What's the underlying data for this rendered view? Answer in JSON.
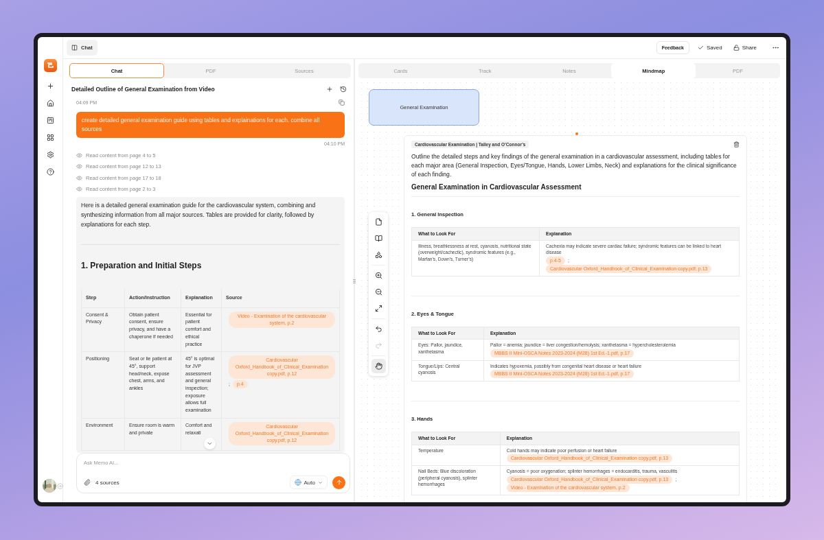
{
  "top_bar": {
    "panel_toggle": "Chat",
    "feedback": "Feedback",
    "saved": "Saved",
    "share": "Share"
  },
  "source_separator": ";",
  "left_panel": {
    "tabs": [
      {
        "label": "Chat",
        "selected": true
      },
      {
        "label": "PDF",
        "selected": false
      },
      {
        "label": "Sources",
        "selected": false
      }
    ],
    "title": "Detailed Outline of General Examination from Video",
    "user_time": "04:09 PM",
    "user_message": "create detailed general examination guide using tables and explainations for each. combine all sources",
    "reply_time": "04:10 PM",
    "steps": [
      "Read content from page 4 to 5",
      "Read content from page 12 to 13",
      "Read content from page 17 to 18",
      "Read content from page 2 to 3"
    ],
    "answer": {
      "intro": "Here is a detailed general examination guide for the cardiovascular system, combining and synthesizing information from all major sources. Tables are provided for clarity, followed by explanations for each step.",
      "heading": "1. Preparation and Initial Steps",
      "columns": [
        "Step",
        "Action/Instruction",
        "Explanation",
        "Source"
      ],
      "rows": [
        {
          "cells": [
            "Consent & Privacy",
            "Obtain patient consent, ensure privacy, and have a chaperone if needed",
            "Essential for patient comfort and ethical practice"
          ],
          "sources": [
            "Video - Examination of the cardiovascular system, p.2"
          ]
        },
        {
          "cells": [
            "Positioning",
            "Seat or lie patient at 45°, support head/neck, expose chest, arms, and ankles",
            "45° is optimal for JVP assessment and general inspection; exposure allows full examination"
          ],
          "sources": [
            "Cardiovascular Oxford_Handbook_of_Clinical_Examination copy.pdf, p.12",
            "p.4"
          ]
        },
        {
          "cells": [
            "Environment",
            "Ensure room is warm and private",
            "Comfort and relaxati"
          ],
          "sources": [
            "Cardiovascular Oxford_Handbook_of_Clinical_Examination copy.pdf, p.12"
          ]
        }
      ]
    },
    "composer": {
      "placeholder": "Ask Memo AI...",
      "sources": "4 sources",
      "mode": "Auto"
    }
  },
  "right_panel": {
    "tabs": [
      {
        "label": "Cards",
        "selected": false
      },
      {
        "label": "Track",
        "selected": false
      },
      {
        "label": "Notes",
        "selected": false
      },
      {
        "label": "Mindmap",
        "selected": true
      },
      {
        "label": "PDF",
        "selected": false
      }
    ],
    "node": "General Examination",
    "tools": [
      {
        "kind": "page",
        "selected": false,
        "disabled": false
      },
      {
        "kind": "book",
        "selected": false,
        "disabled": false
      },
      {
        "kind": "shapes",
        "selected": false,
        "disabled": false
      },
      {
        "kind": "zoom-in",
        "selected": false,
        "disabled": false
      },
      {
        "kind": "zoom-out",
        "selected": false,
        "disabled": false
      },
      {
        "kind": "fit",
        "selected": false,
        "disabled": false
      },
      {
        "kind": "undo",
        "selected": false,
        "disabled": false
      },
      {
        "kind": "redo",
        "selected": false,
        "disabled": true
      },
      {
        "kind": "hand",
        "selected": true,
        "disabled": false
      }
    ],
    "card": {
      "tag": "Cardiovascular Examination | Talley and O’Connor’s",
      "question": "Outline the detailed steps and key findings of the general examination in a cardiovascular assessment, including tables for each major area (General Inspection, Eyes/Tongue, Hands, Lower Limbs, Neck) and explanations for the clinical significance of each finding.",
      "heading": "General Examination in Cardiovascular Assessment",
      "sections": [
        {
          "title": "1. General Inspection",
          "columns": [
            "What to Look For",
            "Explanation"
          ],
          "rows": [
            {
              "look_for": "Illness, breathlessness at rest, cyanosis, nutritional state (overweight/cachectic), syndromic features (e.g., Marfan’s, Down’s, Turner’s)",
              "explanation": "Cachexia may indicate severe cardiac failure; syndromic features can be linked to heart disease",
              "sources": [
                "p.4-5",
                "Cardiovascular Oxford_Handbook_of_Clinical_Examination copy.pdf, p.13"
              ]
            }
          ]
        },
        {
          "title": "2. Eyes & Tongue",
          "columns": [
            "What to Look For",
            "Explanation"
          ],
          "rows": [
            {
              "look_for": "Eyes: Pallor, jaundice, xanthelasma",
              "explanation": "Pallor = anemia; jaundice = liver congestion/hemolysis; xanthelasma = hypercholesterolemia",
              "sources": [
                "MBBS II Mini-OSCA Notes 2023-2024 (M28) 1st Ed.-1.pdf, p.17"
              ]
            },
            {
              "look_for": "Tongue/Lips: Central cyanosis",
              "explanation": "Indicates hypoxemia, possibly from congenital heart disease or heart failure",
              "sources": [
                "MBBS II Mini-OSCA Notes 2023-2024 (M28) 1st Ed.-1.pdf, p.17"
              ]
            }
          ]
        },
        {
          "title": "3. Hands",
          "columns": [
            "What to Look For",
            "Explanation"
          ],
          "rows": [
            {
              "look_for": "Temperature",
              "explanation": "Cold hands may indicate poor perfusion or heart failure",
              "sources": [
                "Cardiovascular Oxford_Handbook_of_Clinical_Examination copy.pdf, p.13"
              ]
            },
            {
              "look_for": "Nail Beds: Blue discoloration (peripheral cyanosis), splinter hemorrhages",
              "explanation": "Cyanosis = poor oxygenation; splinter hemorrhages = endocarditis, trauma, vasculitis",
              "sources": [
                "Cardiovascular Oxford_Handbook_of_Clinical_Examination copy.pdf, p.13",
                "Video - Examination of the cardiovascular system, p.2"
              ]
            }
          ]
        }
      ]
    }
  }
}
